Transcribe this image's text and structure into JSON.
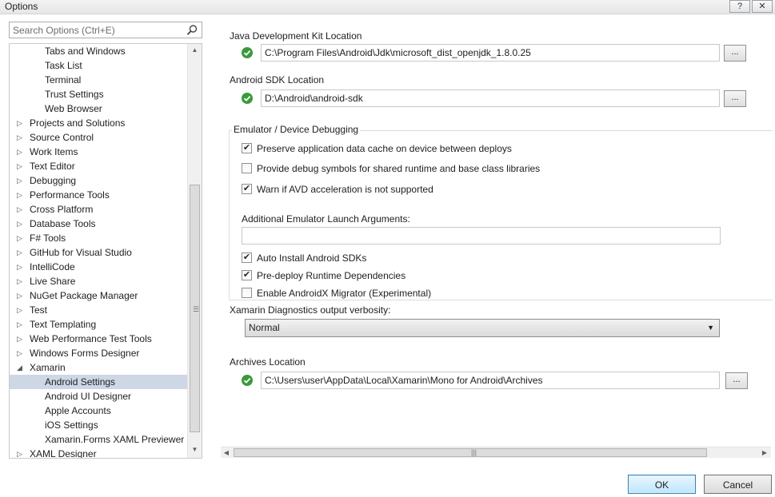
{
  "window": {
    "title": "Options",
    "help_glyph": "?",
    "close_glyph": "✕"
  },
  "search": {
    "placeholder": "Search Options (Ctrl+E)",
    "value": ""
  },
  "tree": {
    "items": [
      {
        "label": "Tabs and Windows",
        "level": 1,
        "expander": ""
      },
      {
        "label": "Task List",
        "level": 1,
        "expander": ""
      },
      {
        "label": "Terminal",
        "level": 1,
        "expander": ""
      },
      {
        "label": "Trust Settings",
        "level": 1,
        "expander": ""
      },
      {
        "label": "Web Browser",
        "level": 1,
        "expander": ""
      },
      {
        "label": "Projects and Solutions",
        "level": 0,
        "expander": "▷"
      },
      {
        "label": "Source Control",
        "level": 0,
        "expander": "▷"
      },
      {
        "label": "Work Items",
        "level": 0,
        "expander": "▷"
      },
      {
        "label": "Text Editor",
        "level": 0,
        "expander": "▷"
      },
      {
        "label": "Debugging",
        "level": 0,
        "expander": "▷"
      },
      {
        "label": "Performance Tools",
        "level": 0,
        "expander": "▷"
      },
      {
        "label": "Cross Platform",
        "level": 0,
        "expander": "▷"
      },
      {
        "label": "Database Tools",
        "level": 0,
        "expander": "▷"
      },
      {
        "label": "F# Tools",
        "level": 0,
        "expander": "▷"
      },
      {
        "label": "GitHub for Visual Studio",
        "level": 0,
        "expander": "▷"
      },
      {
        "label": "IntelliCode",
        "level": 0,
        "expander": "▷"
      },
      {
        "label": "Live Share",
        "level": 0,
        "expander": "▷"
      },
      {
        "label": "NuGet Package Manager",
        "level": 0,
        "expander": "▷"
      },
      {
        "label": "Test",
        "level": 0,
        "expander": "▷"
      },
      {
        "label": "Text Templating",
        "level": 0,
        "expander": "▷"
      },
      {
        "label": "Web Performance Test Tools",
        "level": 0,
        "expander": "▷"
      },
      {
        "label": "Windows Forms Designer",
        "level": 0,
        "expander": "▷"
      },
      {
        "label": "Xamarin",
        "level": 0,
        "expander": "◢"
      },
      {
        "label": "Android Settings",
        "level": 1,
        "expander": "",
        "selected": true
      },
      {
        "label": "Android UI Designer",
        "level": 1,
        "expander": ""
      },
      {
        "label": "Apple Accounts",
        "level": 1,
        "expander": ""
      },
      {
        "label": "iOS Settings",
        "level": 1,
        "expander": ""
      },
      {
        "label": "Xamarin.Forms XAML Previewer",
        "level": 1,
        "expander": ""
      },
      {
        "label": "XAML Designer",
        "level": 0,
        "expander": "▷"
      }
    ]
  },
  "jdk": {
    "label": "Java Development Kit Location",
    "path": "C:\\Program Files\\Android\\Jdk\\microsoft_dist_openjdk_1.8.0.25",
    "browse_label": "..."
  },
  "sdk": {
    "label": "Android SDK Location",
    "path": "D:\\Android\\android-sdk",
    "browse_label": "..."
  },
  "emulator": {
    "group_title": "Emulator / Device Debugging",
    "options": [
      {
        "label": "Preserve application data cache on device between deploys",
        "checked": true
      },
      {
        "label": "Provide debug symbols for shared runtime and base class libraries",
        "checked": false
      },
      {
        "label": "Warn if AVD acceleration is not supported",
        "checked": true
      }
    ],
    "args_label": "Additional Emulator Launch Arguments:",
    "args_value": "",
    "options2": [
      {
        "label": "Auto Install Android SDKs",
        "checked": true
      },
      {
        "label": "Pre-deploy Runtime Dependencies",
        "checked": true
      },
      {
        "label": "Enable AndroidX Migrator (Experimental)",
        "checked": false
      }
    ]
  },
  "diagnostics": {
    "label": "Xamarin Diagnostics output verbosity:",
    "selected": "Normal"
  },
  "archives": {
    "label": "Archives Location",
    "path": "C:\\Users\\user\\AppData\\Local\\Xamarin\\Mono for Android\\Archives",
    "browse_label": "..."
  },
  "scroll_glyphs": {
    "up": "▲",
    "down": "▼",
    "left": "◀",
    "right": "▶",
    "v_grip": "☰",
    "h_grip": "|||"
  },
  "footer": {
    "ok_label": "OK",
    "cancel_label": "Cancel"
  },
  "colors": {
    "valid_check": "#3a9a3a",
    "selection": "#cdd7e6"
  }
}
